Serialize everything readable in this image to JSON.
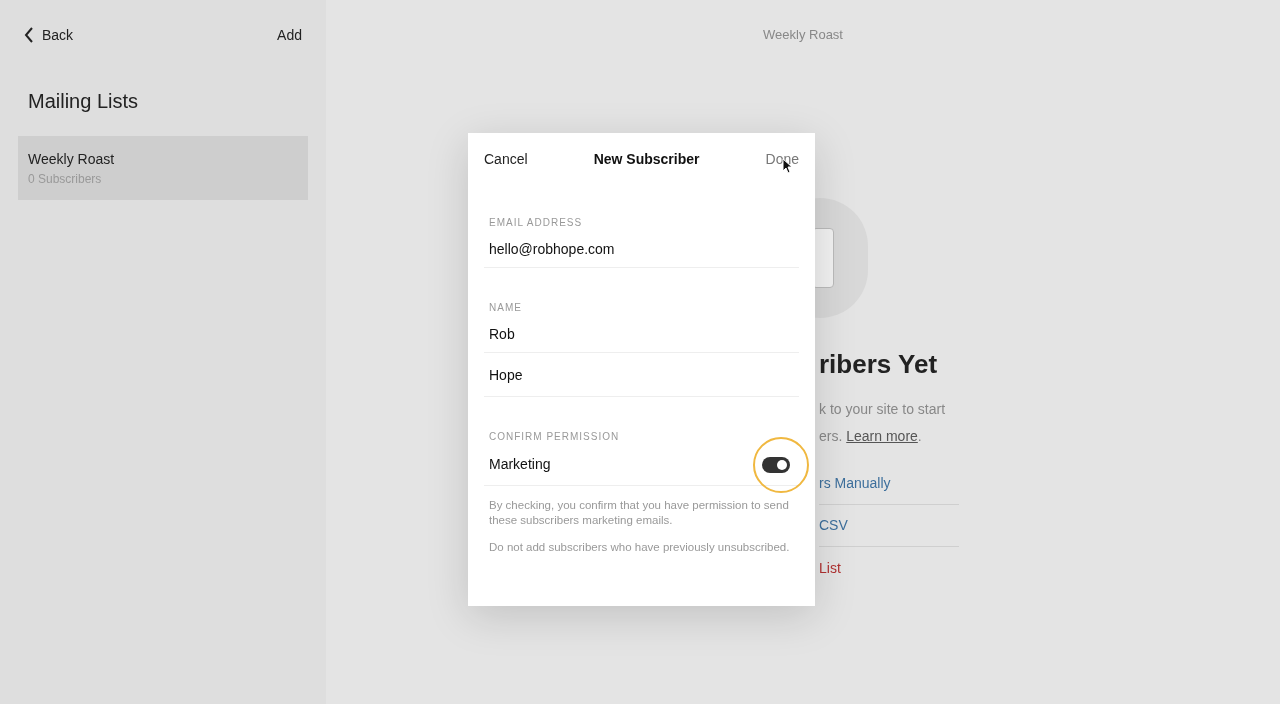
{
  "sidebar": {
    "back": "Back",
    "add": "Add",
    "title": "Mailing Lists",
    "lists": [
      {
        "name": "Weekly Roast",
        "count": "0 Subscribers",
        "selected": true
      }
    ]
  },
  "main": {
    "title": "Weekly Roast",
    "empty_heading": "ribers Yet",
    "empty_line_1": "k to your site to start",
    "empty_line_2": "ers.",
    "learn_more": "Learn more",
    "empty_line_2_end": ".",
    "actions": [
      {
        "label": "rs Manually",
        "kind": "link"
      },
      {
        "label": "CSV",
        "kind": "link"
      },
      {
        "label": "List",
        "kind": "danger"
      }
    ]
  },
  "dialog": {
    "cancel": "Cancel",
    "title": "New Subscriber",
    "done": "Done",
    "email_label": "EMAIL ADDRESS",
    "email": "hello@robhope.com",
    "name_label": "NAME",
    "first_name": "Rob",
    "last_name": "Hope",
    "permission_label": "CONFIRM PERMISSION",
    "toggle_label": "Marketing",
    "toggle_on": true,
    "toggle_highlighted": true,
    "notes": [
      "By checking, you confirm that you have permission to send these subscribers marketing emails.",
      "Do not add subscribers who have previously unsubscribed."
    ]
  }
}
